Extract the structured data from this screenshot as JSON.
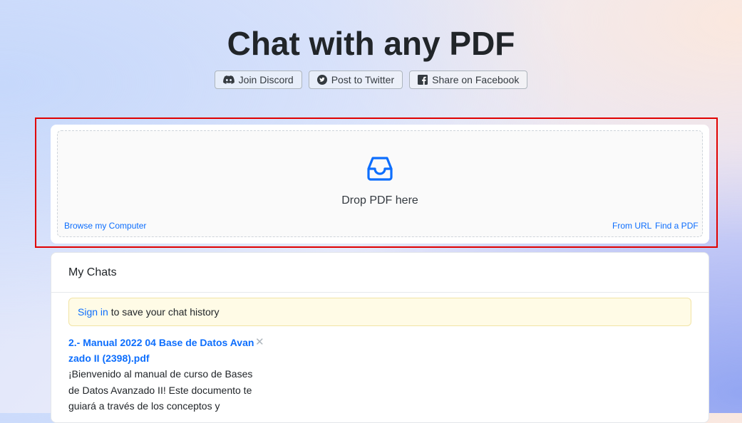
{
  "header": {
    "title": "Chat with any PDF",
    "buttons": [
      {
        "label": "Join Discord",
        "icon": "discord-icon"
      },
      {
        "label": "Post to Twitter",
        "icon": "twitter-icon"
      },
      {
        "label": "Share on Facebook",
        "icon": "facebook-icon"
      }
    ]
  },
  "upload": {
    "icon": "inbox-tray-icon",
    "drop_text": "Drop PDF here",
    "browse_label": "Browse my Computer",
    "from_url_label": "From URL",
    "find_pdf_label": "Find a PDF"
  },
  "my_chats": {
    "heading": "My Chats",
    "signin_link": "Sign in",
    "signin_rest": " to save your chat history",
    "items": [
      {
        "title": "2.- Manual 2022 04 Base de Datos Avanzado II (2398).pdf",
        "close_symbol": "✕",
        "description": "¡Bienvenido al manual de curso de Bases de Datos Avanzado II! Este documento te guiará a través de los conceptos y"
      }
    ]
  },
  "colors": {
    "accent": "#0d6efd",
    "highlight_border": "#e00000",
    "alert_background": "#fffbe6"
  }
}
